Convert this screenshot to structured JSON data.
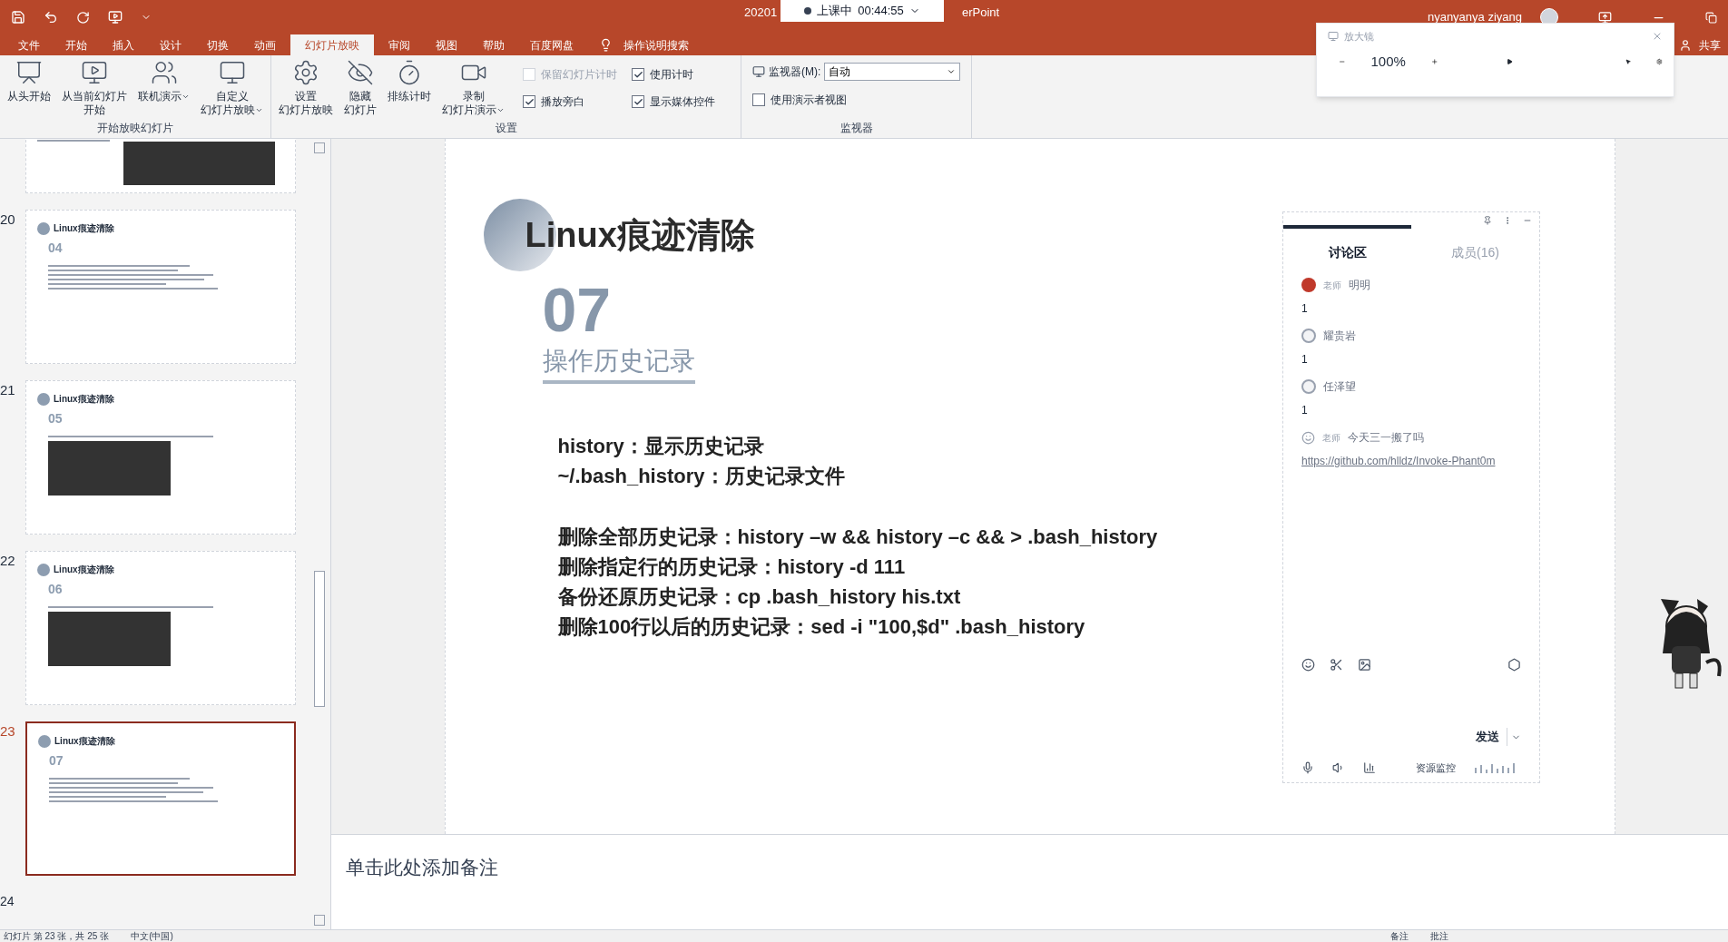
{
  "title_bar": {
    "title": "20201",
    "recording": {
      "status": "上课中",
      "time": "00:44:55"
    },
    "app_suffix": "erPoint",
    "user": "nyanyanya ziyang"
  },
  "tabs": [
    {
      "label": "文件",
      "selected": false
    },
    {
      "label": "开始",
      "selected": false
    },
    {
      "label": "插入",
      "selected": false
    },
    {
      "label": "设计",
      "selected": false
    },
    {
      "label": "切换",
      "selected": false
    },
    {
      "label": "动画",
      "selected": false
    },
    {
      "label": "幻灯片放映",
      "selected": true
    },
    {
      "label": "审阅",
      "selected": false
    },
    {
      "label": "视图",
      "selected": false
    },
    {
      "label": "帮助",
      "selected": false
    },
    {
      "label": "百度网盘",
      "selected": false
    }
  ],
  "search_label": "操作说明搜索",
  "share_label": "共享",
  "ribbon_groups": [
    {
      "title": "开始放映幻灯片",
      "buttons": [
        {
          "kind": "play",
          "lines": [
            "从头开始"
          ],
          "dropdown": false
        },
        {
          "kind": "current",
          "lines": [
            "从当前幻灯片",
            "开始"
          ],
          "dropdown": false
        },
        {
          "kind": "online",
          "lines": [
            "联机演示"
          ],
          "dropdown": true
        },
        {
          "kind": "custom",
          "lines": [
            "自定义",
            "幻灯片放映"
          ],
          "dropdown": true
        }
      ]
    },
    {
      "title": "设置",
      "buttons": [
        {
          "kind": "setup",
          "lines": [
            "设置",
            "幻灯片放映"
          ],
          "dropdown": false
        },
        {
          "kind": "hide",
          "lines": [
            "隐藏",
            "幻灯片"
          ],
          "dropdown": false
        },
        {
          "kind": "timer",
          "lines": [
            "排练计时"
          ],
          "dropdown": false
        },
        {
          "kind": "record",
          "lines": [
            "录制",
            "幻灯片演示"
          ],
          "dropdown": true
        }
      ],
      "checkboxes": [
        {
          "label": "保留幻灯片计时",
          "checked": false,
          "disabled": true
        },
        {
          "label": "使用计时",
          "checked": true,
          "disabled": false
        },
        {
          "label": "播放旁白",
          "checked": true,
          "disabled": false
        },
        {
          "label": "显示媒体控件",
          "checked": true,
          "disabled": false
        }
      ]
    },
    {
      "title": "监视器",
      "monitor": {
        "label": "监视器(M):",
        "value": "自动"
      },
      "checkboxes": [
        {
          "label": "使用演示者视图",
          "checked": false,
          "disabled": false
        }
      ]
    }
  ],
  "magnifier": {
    "title": "放大镜",
    "zoom": "100%"
  },
  "thumbnails": [
    {
      "kind": "partial"
    },
    {
      "number": "20",
      "kind": "text",
      "heading": "Linux痕迹清除",
      "section": "04",
      "selected": false
    },
    {
      "number": "21",
      "kind": "image",
      "heading": "Linux痕迹清除",
      "section": "05",
      "selected": false
    },
    {
      "number": "22",
      "kind": "image",
      "heading": "Linux痕迹清除",
      "section": "06",
      "selected": false
    },
    {
      "number": "23",
      "kind": "text",
      "heading": "Linux痕迹清除",
      "section": "07",
      "selected": true
    },
    {
      "number": "24",
      "kind": "cut"
    }
  ],
  "slide": {
    "heading": "Linux痕迹清除",
    "number": "07",
    "subtitle": "操作历史记录",
    "blocks": [
      [
        "history：显示历史记录",
        "~/.bash_history：历史记录文件"
      ],
      [
        "删除全部历史记录：history –w && history –c && > .bash_history",
        "删除指定行的历史记录：history -d 111",
        "备份还原历史记录：cp .bash_history his.txt",
        "删除100行以后的历史记录：sed -i \"100,$d\" .bash_history"
      ]
    ]
  },
  "notes_placeholder": "单击此处添加备注",
  "chat": {
    "tabs": [
      {
        "label": "讨论区",
        "selected": true
      },
      {
        "label": "成员(16)",
        "selected": false
      }
    ],
    "messages": [
      {
        "kind": "teacher",
        "role": "老师",
        "name": "明明",
        "color": "#c0392b",
        "text": "1"
      },
      {
        "kind": "student",
        "name": "耀贵岩",
        "text": "1"
      },
      {
        "kind": "student",
        "name": "任泽望",
        "text": "1"
      },
      {
        "kind": "teacher_emoji",
        "role": "老师",
        "name": "今天三一搬了吗",
        "link": "https://github.com/hlldz/Invoke-Phant0m"
      }
    ],
    "send_label": "发送",
    "monitor_label": "资源监控"
  },
  "status_bar": {
    "left": [
      "幻灯片 第 23 张，共 25 张",
      "中文(中国)"
    ],
    "right": [
      "备注",
      "批注"
    ]
  }
}
